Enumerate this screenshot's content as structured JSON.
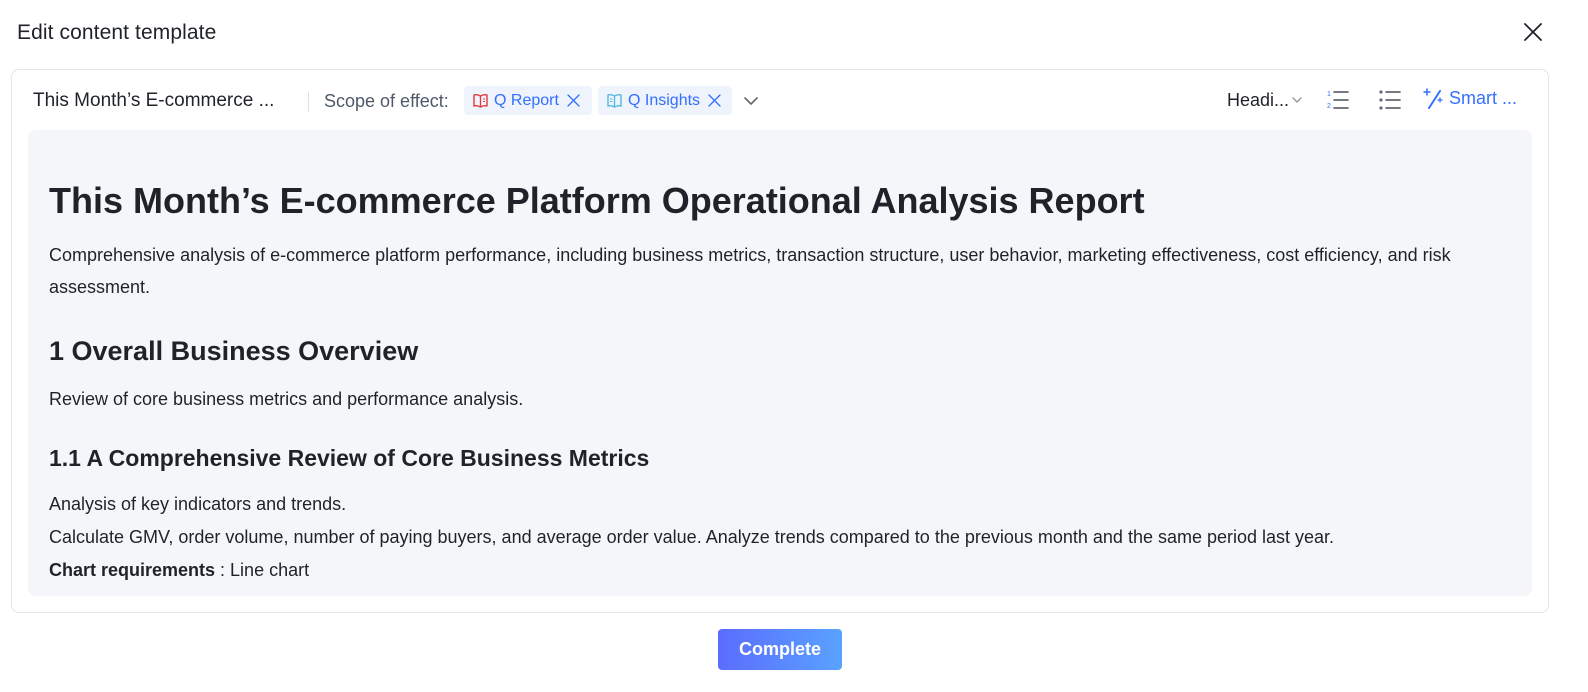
{
  "dialog": {
    "title": "Edit content template",
    "close_icon": "close-icon"
  },
  "toolbar": {
    "template_name": "This Month’s E-commerce ...",
    "scope_label": "Scope of effect:",
    "scope_tags": [
      {
        "label": "Q Report",
        "icon": "report-book-icon",
        "icon_color": "#e03b3b"
      },
      {
        "label": "Q Insights",
        "icon": "insights-book-icon",
        "icon_color": "#53b8e0"
      }
    ],
    "heading_select": "Headi...",
    "smart_label": "Smart ...",
    "accent_color": "#3370ff"
  },
  "document": {
    "title": "This Month’s E-commerce Platform Operational Analysis Report",
    "description": "Comprehensive analysis of e-commerce platform performance, including business metrics, transaction structure, user behavior, marketing effectiveness, cost efficiency, and risk assessment.",
    "section1_heading": "1 Overall Business Overview",
    "section1_text": "Review of core business metrics and performance analysis.",
    "section11_heading": "1.1 A Comprehensive Review of Core Business Metrics",
    "section11_text1": "Analysis of key indicators and trends.",
    "section11_text2": "Calculate GMV, order volume, number of paying buyers, and average order value. Analyze trends compared to the previous month and the same period last year.",
    "chart_req_label": "Chart requirements",
    "chart_req_value": " : Line chart"
  },
  "footer": {
    "complete_label": "Complete"
  }
}
